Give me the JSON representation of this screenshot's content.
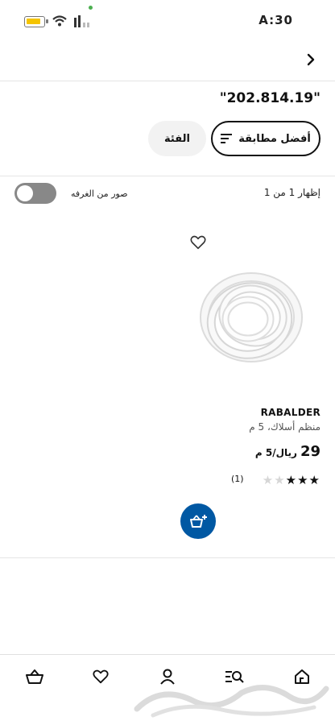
{
  "status_bar": {
    "time": "A:30"
  },
  "search": {
    "query_title": "\"202.814.19\""
  },
  "filters": {
    "sort_label": "أفضل مطابقة",
    "category_label": "الفئة"
  },
  "results": {
    "count_text": "إظهار 1 من 1",
    "room_images_label": "صور من الغرفه",
    "room_images_on": false
  },
  "product": {
    "name": "RABALDER",
    "description": "منظم أسلاك، 5 م",
    "price": "29",
    "price_unit": "ريال/5 م",
    "rating": 3,
    "rating_max": 5,
    "reviews": "(1)"
  },
  "colors": {
    "accent": "#0058a3",
    "battery": "#f5c400"
  },
  "bottom_nav": [
    "home-icon",
    "search-list-icon",
    "profile-icon",
    "heart-icon",
    "basket-icon"
  ]
}
